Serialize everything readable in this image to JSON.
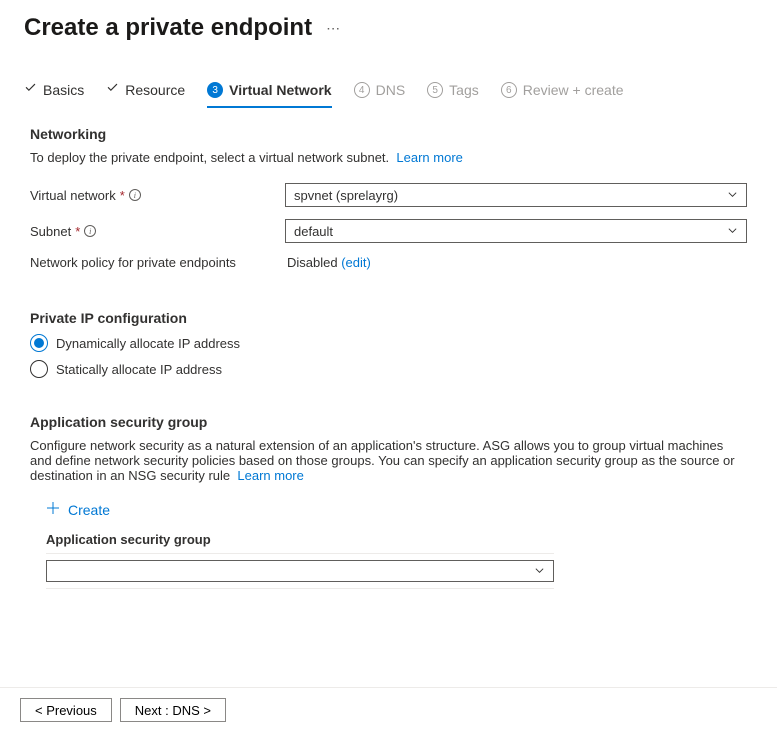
{
  "header": {
    "title": "Create a private endpoint"
  },
  "tabs": {
    "basics": "Basics",
    "resource": "Resource",
    "virtual_network": {
      "step": "3",
      "label": "Virtual Network"
    },
    "dns": {
      "step": "4",
      "label": "DNS"
    },
    "tags": {
      "step": "5",
      "label": "Tags"
    },
    "review": {
      "step": "6",
      "label": "Review + create"
    }
  },
  "networking": {
    "title": "Networking",
    "desc": "To deploy the private endpoint, select a virtual network subnet.",
    "learn_more": "Learn more",
    "vnet_label": "Virtual network",
    "vnet_value": "spvnet (sprelayrg)",
    "subnet_label": "Subnet",
    "subnet_value": "default",
    "policy_label": "Network policy for private endpoints",
    "policy_value": "Disabled",
    "policy_edit": "(edit)"
  },
  "ip_config": {
    "title": "Private IP configuration",
    "dynamic": "Dynamically allocate IP address",
    "static": "Statically allocate IP address"
  },
  "asg": {
    "title": "Application security group",
    "desc": "Configure network security as a natural extension of an application's structure. ASG allows you to group virtual machines and define network security policies based on those groups. You can specify an application security group as the source or destination in an NSG security rule",
    "learn_more": "Learn more",
    "create": "Create",
    "col_header": "Application security group"
  },
  "footer": {
    "previous": "<  Previous",
    "next": "Next : DNS  >"
  }
}
